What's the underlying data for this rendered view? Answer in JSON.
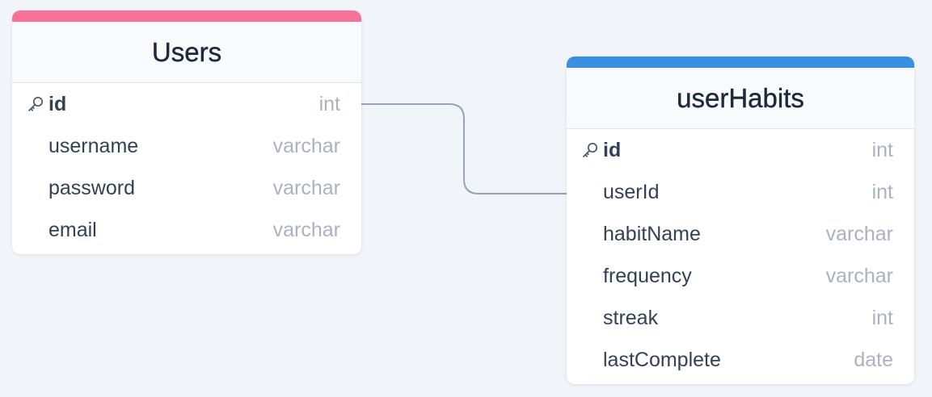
{
  "colors": {
    "background": "#f1f5f9",
    "users_accent": "#f87199",
    "user_habits_accent": "#3b8fe0",
    "connector": "#94a3b8"
  },
  "tables": {
    "users": {
      "name": "Users",
      "fields": [
        {
          "name": "id",
          "type": "int",
          "primary_key": true,
          "icon": "key-icon"
        },
        {
          "name": "username",
          "type": "varchar"
        },
        {
          "name": "password",
          "type": "varchar"
        },
        {
          "name": "email",
          "type": "varchar"
        }
      ]
    },
    "user_habits": {
      "name": "userHabits",
      "fields": [
        {
          "name": "id",
          "type": "int",
          "primary_key": true,
          "icon": "key-icon"
        },
        {
          "name": "userId",
          "type": "int"
        },
        {
          "name": "habitName",
          "type": "varchar"
        },
        {
          "name": "frequency",
          "type": "varchar"
        },
        {
          "name": "streak",
          "type": "int"
        },
        {
          "name": "lastComplete",
          "type": "date"
        }
      ]
    }
  },
  "relationships": [
    {
      "from": "Users.id",
      "to": "userHabits.userId"
    }
  ]
}
